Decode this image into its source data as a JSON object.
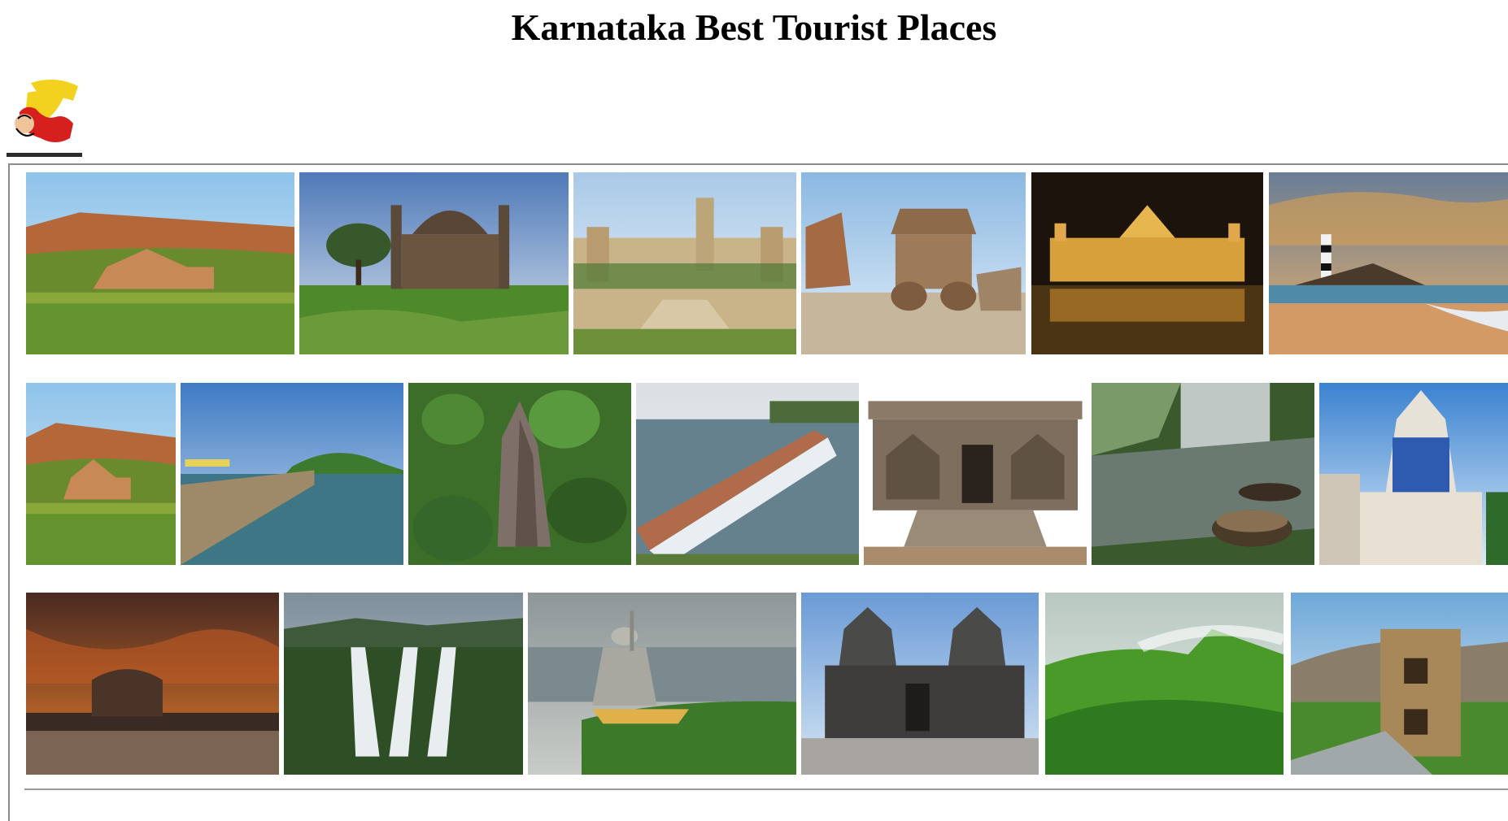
{
  "page": {
    "title": "Karnataka Best Tourist Places"
  },
  "logo": {
    "icon": "karnataka-flag-figure-logo",
    "colors": {
      "yellow": "#f2d21e",
      "red": "#d6201e"
    }
  },
  "gallery": {
    "rows": [
      [
        {
          "name": "badami-cave-temple-photo",
          "scene": "cliff-temple-lake"
        },
        {
          "name": "gol-gumbaz-photo",
          "scene": "domed-monument"
        },
        {
          "name": "bangalore-palace-photo",
          "scene": "castle-palace"
        },
        {
          "name": "hampi-stone-chariot-photo",
          "scene": "stone-chariot"
        },
        {
          "name": "mysore-palace-night-photo",
          "scene": "palace-lights"
        },
        {
          "name": "kaup-beach-lighthouse-photo",
          "scene": "beach-lighthouse"
        }
      ],
      [
        {
          "name": "cliff-lake-temple-photo",
          "scene": "cliff-temple-lake"
        },
        {
          "name": "reservoir-dam-photo",
          "scene": "dam-lake"
        },
        {
          "name": "yana-rock-forest-photo",
          "scene": "rock-forest"
        },
        {
          "name": "krs-dam-photo",
          "scene": "dam-gates"
        },
        {
          "name": "hoysala-temple-entrance-photo",
          "scene": "carved-temple"
        },
        {
          "name": "hogenakkal-coracle-photo",
          "scene": "river-coracle"
        },
        {
          "name": "gopuram-temple-photo",
          "scene": "gopuram"
        }
      ],
      [
        {
          "name": "mysore-palace-sunset-photo",
          "scene": "palace-sunset"
        },
        {
          "name": "jog-falls-photo",
          "scene": "waterfall"
        },
        {
          "name": "murudeshwar-shiva-photo",
          "scene": "shiva-statue"
        },
        {
          "name": "belur-temple-photo",
          "scene": "stone-temple"
        },
        {
          "name": "western-ghats-hills-photo",
          "scene": "green-hills"
        },
        {
          "name": "chitradurga-fort-photo",
          "scene": "fort-tower"
        }
      ]
    ]
  }
}
